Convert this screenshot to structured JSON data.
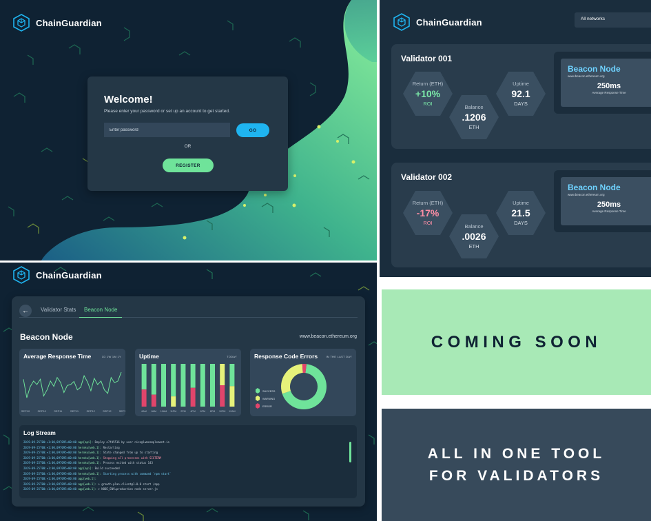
{
  "brand": {
    "name": "ChainGuardian",
    "logo_icon": "cube-hexagon-icon"
  },
  "colors": {
    "navy": "#0f2233",
    "card": "#243746",
    "accent_green": "#6fe39a",
    "accent_blue": "#1fb4f0",
    "error_pink": "#e0456b",
    "warning_yellow": "#e6f27a"
  },
  "login": {
    "title": "Welcome!",
    "subtitle": "Please enter your password or set up an account to get started.",
    "password_placeholder": "Enter password",
    "go_label": "GO",
    "or_label": "OR",
    "register_label": "REGISTER"
  },
  "validators_screen": {
    "network_select": "All networks",
    "validators": [
      {
        "name": "Validator 001",
        "return_label": "Return (ETH)",
        "return_value": "+10%",
        "roi_label": "ROI",
        "balance_label": "Balance",
        "balance_value": ".1206",
        "balance_unit": "ETH",
        "uptime_label": "Uptime",
        "uptime_value": "92.1",
        "uptime_unit": "DAYS",
        "beacon_title": "Beacon Node",
        "beacon_url": "www.beacon.ethereum.org",
        "beacon_ms": "250ms",
        "beacon_caption": "Average Response Time"
      },
      {
        "name": "Validator 002",
        "return_label": "Return (ETH)",
        "return_value": "-17%",
        "roi_label": "ROI",
        "balance_label": "Balance",
        "balance_value": ".0026",
        "balance_unit": "ETH",
        "uptime_label": "Uptime",
        "uptime_value": "21.5",
        "uptime_unit": "DAYS",
        "beacon_title": "Beacon Node",
        "beacon_url": "www.beacon.ethereum.org",
        "beacon_ms": "250ms",
        "beacon_caption": "Average Response Time"
      }
    ]
  },
  "dashboard": {
    "tabs": [
      "Validator Stats",
      "Beacon Node"
    ],
    "active_tab": "Beacon Node",
    "title": "Beacon Node",
    "url": "www.beacon.ethereum.org",
    "response_time": {
      "title": "Average Response Time",
      "range": "1D 1W 1M 1Y"
    },
    "uptime": {
      "title": "Uptime",
      "range": "TODAY"
    },
    "errors": {
      "title": "Response Code Errors",
      "range": "IN THE LAST DAY"
    },
    "log": {
      "title": "Log Stream",
      "lines": [
        {
          "ts": "2019-09-25T00:+1:00,097095+00:00",
          "src": "app[api]:",
          "msg": "Deploy e7fd5516 by user nico@lwmcomplement.io",
          "kind": "normal"
        },
        {
          "ts": "2019-09-25T00:+1:00,097095+00:00",
          "src": "heroku[web.1]:",
          "msg": "Restarting",
          "kind": "normal"
        },
        {
          "ts": "2019-09-25T00:+1:00,097095+00:00",
          "src": "heroku[web.1]:",
          "msg": "State changed from up to starting",
          "kind": "normal"
        },
        {
          "ts": "2019-09-25T00:+1:00,097095+00:00",
          "src": "heroku[web.1]:",
          "msg": "Stopping all processes with SIGTERM",
          "kind": "warn"
        },
        {
          "ts": "2019-09-25T00:+1:00,097095+00:00",
          "src": "heroku[web.1]:",
          "msg": "Process exited with status 143",
          "kind": "normal"
        },
        {
          "ts": "2019-09-25T00:+1:00,097095+00:00",
          "src": "app[api]:",
          "msg": "Build succeeded",
          "kind": "normal"
        },
        {
          "ts": "2019-09-25T00:+1:00,097095+00:00",
          "src": "heroku[web.1]:",
          "msg": "Starting process with command `npm start`",
          "kind": "cmd"
        },
        {
          "ts": "2019-09-25T00:+1:00,097095+00:00",
          "src": "app[web.1]:",
          "msg": "",
          "kind": "normal"
        },
        {
          "ts": "2019-09-25T00:+1:00,097095+00:00",
          "src": "app[web.1]:",
          "msg": "> growth-plan-client@1.0.0 start /app",
          "kind": "normal"
        },
        {
          "ts": "2019-09-25T00:+1:00,097095+00:00",
          "src": "app[web.1]:",
          "msg": "> NODE_ENV=production node server.js",
          "kind": "normal"
        }
      ]
    }
  },
  "chart_data": [
    {
      "type": "line",
      "title": "Average Response Time",
      "categories": [
        "SEP10",
        "SEP10",
        "SEP11",
        "SEP11",
        "SEP12",
        "SEP12",
        "SEP13"
      ],
      "series": [
        {
          "values": [
            62,
            20,
            45,
            58,
            50,
            62,
            24,
            38,
            58,
            46,
            66,
            55,
            32,
            48,
            50,
            57,
            38,
            44,
            70,
            56,
            36,
            64,
            50,
            58,
            38,
            30,
            66,
            54,
            58,
            78
          ]
        }
      ],
      "ylim": [
        0,
        100
      ]
    },
    {
      "type": "bar",
      "title": "Uptime",
      "categories": [
        "6AM",
        "8AM",
        "10AM",
        "11PM",
        "2PM",
        "4PM",
        "6PM",
        "8PM",
        "10PM",
        "12AM"
      ],
      "series": [
        {
          "name": "SUCCESS",
          "values": [
            60,
            72,
            100,
            76,
            100,
            56,
            100,
            100,
            0,
            52
          ]
        },
        {
          "name": "WARNING",
          "values": [
            0,
            0,
            0,
            24,
            0,
            0,
            0,
            0,
            50,
            48
          ]
        },
        {
          "name": "ERROR",
          "values": [
            40,
            28,
            0,
            0,
            0,
            44,
            0,
            0,
            50,
            0
          ]
        }
      ],
      "ylim": [
        0,
        100
      ]
    },
    {
      "type": "pie",
      "title": "Response Code Errors",
      "categories": [
        "SUCCESS",
        "WARNING",
        "ERROR"
      ],
      "values": [
        68,
        29,
        3
      ]
    }
  ],
  "banners": {
    "coming_soon": "COMING SOON",
    "tagline_line1": "ALL IN ONE TOOL",
    "tagline_line2": "FOR VALIDATORS"
  }
}
